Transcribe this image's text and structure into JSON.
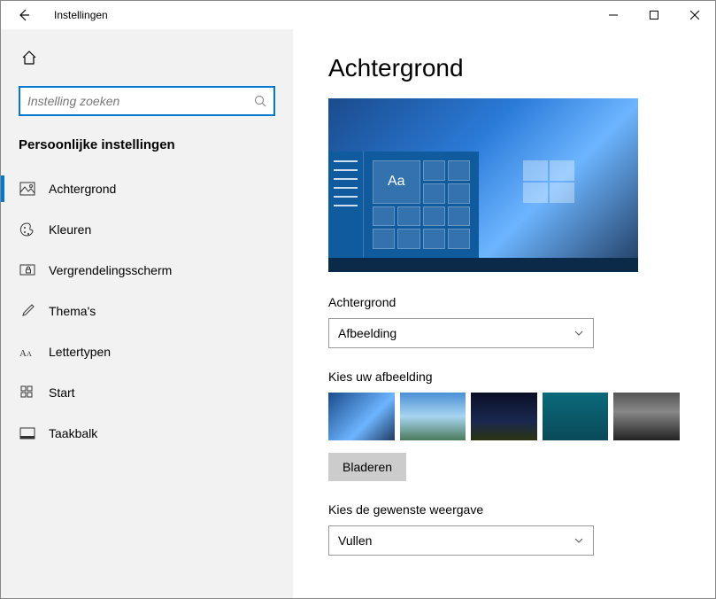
{
  "window": {
    "title": "Instellingen"
  },
  "search": {
    "placeholder": "Instelling zoeken"
  },
  "sidebar": {
    "section_title": "Persoonlijke instellingen",
    "items": [
      {
        "label": "Achtergrond"
      },
      {
        "label": "Kleuren"
      },
      {
        "label": "Vergrendelingsscherm"
      },
      {
        "label": "Thema's"
      },
      {
        "label": "Lettertypen"
      },
      {
        "label": "Start"
      },
      {
        "label": "Taakbalk"
      }
    ]
  },
  "page": {
    "title": "Achtergrond",
    "preview_sample": "Aa",
    "bg_label": "Achtergrond",
    "bg_value": "Afbeelding",
    "choose_img_label": "Kies uw afbeelding",
    "browse_label": "Bladeren",
    "fit_label": "Kies de gewenste weergave",
    "fit_value": "Vullen"
  }
}
